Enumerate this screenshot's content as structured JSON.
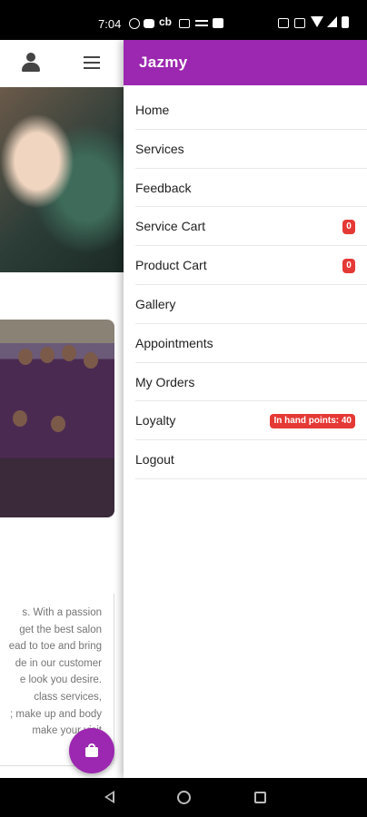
{
  "status_bar": {
    "time": "7:04",
    "cb_label": "cb",
    "icons": [
      "whatsapp-icon",
      "youtube-icon",
      "cb-icon",
      "mail-icon",
      "cast-icon",
      "image-icon",
      "nfc-icon",
      "data-icon",
      "wifi-icon",
      "signal-icon",
      "battery-icon"
    ]
  },
  "background_page": {
    "about_text": "s. With a passion\nget the best salon\nead to toe and bring\nde in our customer\ne look you desire.\nclass services,\n; make up and body\nmake your visit",
    "fab_icon": "shopping-bag-icon"
  },
  "drawer": {
    "title": "Jazmy",
    "accent_color": "#9c27b0",
    "badge_color": "#e53935",
    "items": [
      {
        "label": "Home"
      },
      {
        "label": "Services"
      },
      {
        "label": "Feedback"
      },
      {
        "label": "Service Cart",
        "badge": "0"
      },
      {
        "label": "Product Cart",
        "badge": "0"
      },
      {
        "label": "Gallery"
      },
      {
        "label": "Appointments"
      },
      {
        "label": "My Orders"
      },
      {
        "label": "Loyalty",
        "badge": "In hand points: 40"
      },
      {
        "label": "Logout"
      }
    ]
  }
}
